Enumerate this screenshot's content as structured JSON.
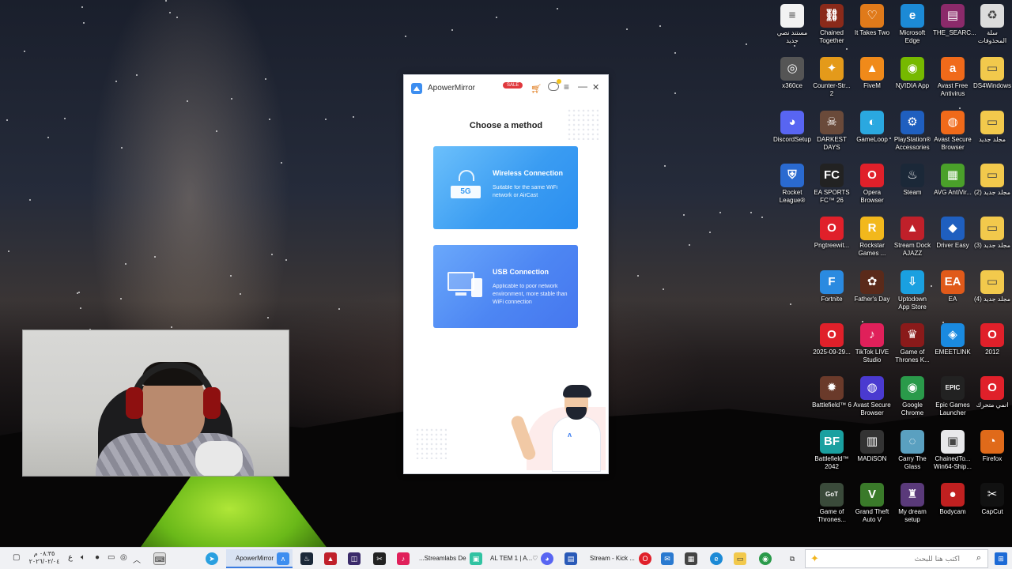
{
  "app": {
    "title": "ApowerMirror",
    "sale_badge": "SALE",
    "heading": "Choose a method",
    "wireless": {
      "badge": "5G",
      "title": "Wireless Connection",
      "desc": "Suitable for the same WiFi network or AirCast"
    },
    "usb": {
      "title": "USB Connection",
      "desc": "Applicable to poor network environment, more stable than WiFi connection"
    },
    "illustration_logo": "ᴧ"
  },
  "desktop_icons": [
    {
      "label": "مستند نصي جديد",
      "icon": "text-document-icon",
      "color": "#f2f2f2",
      "glyph": "≡"
    },
    {
      "label": "Chained Together",
      "icon": "game-icon",
      "color": "#8a2a1a",
      "glyph": "⛓"
    },
    {
      "label": "It Takes Two",
      "icon": "game-icon",
      "color": "#e07a1a",
      "glyph": "♡"
    },
    {
      "label": "Microsoft Edge",
      "icon": "edge-icon",
      "color": "#1c8ad6",
      "glyph": "e"
    },
    {
      "label": "THE_SEARC...",
      "icon": "winrar-icon",
      "color": "#8b2a6a",
      "glyph": "▤"
    },
    {
      "label": "سلة المحذوفات",
      "icon": "recycle-bin-icon",
      "color": "#dcdcdc",
      "glyph": "♻"
    },
    {
      "label": "x360ce",
      "icon": "gamepad-icon",
      "color": "#555",
      "glyph": "◎"
    },
    {
      "label": "Counter-Str... 2",
      "icon": "game-icon",
      "color": "#e49a1a",
      "glyph": "✦"
    },
    {
      "label": "FiveM",
      "icon": "fivem-icon",
      "color": "#f08a1a",
      "glyph": "▲"
    },
    {
      "label": "NVIDIA App",
      "icon": "nvidia-icon",
      "color": "#76b900",
      "glyph": "◉"
    },
    {
      "label": "Avast Free Antivirus",
      "icon": "avast-icon",
      "color": "#f06a1a",
      "glyph": "a"
    },
    {
      "label": "DS4Windows",
      "icon": "folder-icon",
      "color": "#f2c94c",
      "glyph": "▭"
    },
    {
      "label": "DiscordSetup",
      "icon": "discord-icon",
      "color": "#5865f2",
      "glyph": "◕"
    },
    {
      "label": "DARKEST DAYS",
      "icon": "game-icon",
      "color": "#6a4a3a",
      "glyph": "☠"
    },
    {
      "label": "GameLoop",
      "icon": "gameloop-icon",
      "color": "#2aa8e0",
      "glyph": "◐"
    },
    {
      "label": "PlayStation® Accessories",
      "icon": "playstation-icon",
      "color": "#1f5fbf",
      "glyph": "⚙"
    },
    {
      "label": "Avast Secure Browser",
      "icon": "avast-browser-icon",
      "color": "#f06a1a",
      "glyph": "◍"
    },
    {
      "label": "مجلد جديد",
      "icon": "folder-icon",
      "color": "#f2c94c",
      "glyph": "▭"
    },
    {
      "label": "Rocket League®",
      "icon": "rocket-league-icon",
      "color": "#2a6ad0",
      "glyph": "⛨"
    },
    {
      "label": "EA SPORTS FC™ 26",
      "icon": "ea-fc-icon",
      "color": "#222",
      "glyph": "FC"
    },
    {
      "label": "Opera Browser",
      "icon": "opera-icon",
      "color": "#e0202a",
      "glyph": "O"
    },
    {
      "label": "Steam",
      "icon": "steam-icon",
      "color": "#1b2838",
      "glyph": "♨"
    },
    {
      "label": "AVG AntiVir...",
      "icon": "avg-icon",
      "color": "#4aa02a",
      "glyph": "▦"
    },
    {
      "label": "مجلد جديد (2)",
      "icon": "folder-icon",
      "color": "#f2c94c",
      "glyph": "▭"
    },
    {
      "label": "Pngtreewit...",
      "icon": "opera-icon",
      "color": "#e0202a",
      "glyph": "O"
    },
    {
      "label": "Rockstar Games ...",
      "icon": "rockstar-icon",
      "color": "#f2b81c",
      "glyph": "R"
    },
    {
      "label": "Stream Dock AJAZZ",
      "icon": "stream-dock-icon",
      "color": "#c0202a",
      "glyph": "▲"
    },
    {
      "label": "Driver Easy",
      "icon": "driver-easy-icon",
      "color": "#1f5fbf",
      "glyph": "◆"
    },
    {
      "label": "مجلد جديد (3)",
      "icon": "folder-icon",
      "color": "#f2c94c",
      "glyph": "▭"
    },
    {
      "label": "Fortnite",
      "icon": "fortnite-icon",
      "color": "#2a8ae0",
      "glyph": "F"
    },
    {
      "label": "Father's Day",
      "icon": "image-icon",
      "color": "#5a2a1a",
      "glyph": "✿"
    },
    {
      "label": "Uptodown App Store",
      "icon": "uptodown-icon",
      "color": "#1aa0e0",
      "glyph": "⇩"
    },
    {
      "label": "EA",
      "icon": "ea-icon",
      "color": "#e05a1a",
      "glyph": "EA"
    },
    {
      "label": "مجلد جديد (4)",
      "icon": "folder-icon",
      "color": "#f2c94c",
      "glyph": "▭"
    },
    {
      "label": "2025-09-29...",
      "icon": "opera-icon",
      "color": "#e0202a",
      "glyph": "O"
    },
    {
      "label": "TikTok LIVE Studio",
      "icon": "tiktok-icon",
      "color": "#e0205a",
      "glyph": "♪"
    },
    {
      "label": "Game of Thrones K...",
      "icon": "game-icon",
      "color": "#8a1a1a",
      "glyph": "♛"
    },
    {
      "label": "EMEETLINK",
      "icon": "emeetlink-icon",
      "color": "#1a8ae0",
      "glyph": "◈"
    },
    {
      "label": "2012",
      "icon": "opera-icon",
      "color": "#e0202a",
      "glyph": "O"
    },
    {
      "label": "Battlefield™ 6",
      "icon": "game-icon",
      "color": "#6a3a2a",
      "glyph": "✹"
    },
    {
      "label": "Avast Secure Browser",
      "icon": "avast-browser-icon",
      "color": "#4a3ad0",
      "glyph": "◍"
    },
    {
      "label": "Google Chrome",
      "icon": "chrome-icon",
      "color": "#2a9a4a",
      "glyph": "◉"
    },
    {
      "label": "Epic Games Launcher",
      "icon": "epic-games-icon",
      "color": "#222",
      "glyph": "EPIC"
    },
    {
      "label": "انمي متحرك",
      "icon": "opera-icon",
      "color": "#e0202a",
      "glyph": "O"
    },
    {
      "label": "Battlefield™ 2042",
      "icon": "game-icon",
      "color": "#1aa0a0",
      "glyph": "BF"
    },
    {
      "label": "MADiSON",
      "icon": "game-icon",
      "color": "#333",
      "glyph": "▥"
    },
    {
      "label": "Carry The Glass",
      "icon": "game-icon",
      "color": "#5aa0c0",
      "glyph": "◌"
    },
    {
      "label": "ChainedTo... Win64-Ship...",
      "icon": "shortcut-icon",
      "color": "#e8e8ea",
      "glyph": "▣"
    },
    {
      "label": "Firefox",
      "icon": "firefox-icon",
      "color": "#e06a1a",
      "glyph": "◔"
    },
    {
      "label": "Game of Thrones...",
      "icon": "game-icon",
      "color": "#3a4a3a",
      "glyph": "GoT"
    },
    {
      "label": "Grand Theft Auto V",
      "icon": "gta-icon",
      "color": "#3a7a2a",
      "glyph": "V"
    },
    {
      "label": "My dream setup",
      "icon": "game-icon",
      "color": "#5a3a7a",
      "glyph": "♜"
    },
    {
      "label": "Bodycam",
      "icon": "bodycam-icon",
      "color": "#c02020",
      "glyph": "●"
    },
    {
      "label": "CapCut",
      "icon": "capcut-icon",
      "color": "#111",
      "glyph": "✂"
    }
  ],
  "taskbar": {
    "clock_time": "٠٨:٣٥ م",
    "clock_date": "٢٠٢٦/٠٢/٠٤",
    "lang": "ع",
    "apps": [
      {
        "label": "ApowerMirror",
        "active": true
      },
      {
        "label": "...Streamlabs De",
        "active": false
      },
      {
        "label": "AL TEM 1 | A...♡",
        "active": false
      },
      {
        "label": "Stream - Kick ...",
        "active": false
      }
    ],
    "search_placeholder": "اكتب هنا للبحث"
  }
}
